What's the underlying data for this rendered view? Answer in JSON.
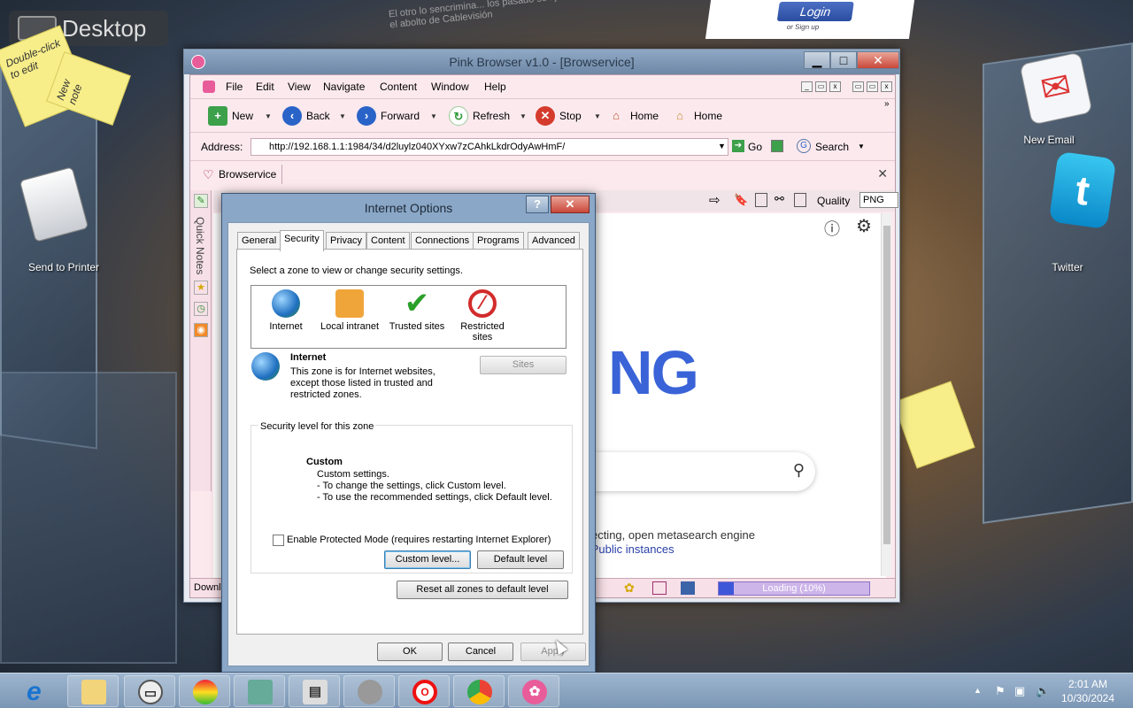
{
  "desktop": {
    "title": "Desktop",
    "note_a": "Double-click to edit",
    "note_b": "New note",
    "send_to_printer": "Send to Printer",
    "new_email": "New Email",
    "twitter": "Twitter",
    "login": "Login",
    "signup": "or Sign up",
    "bg_text": "El otro lo sencrimina... los pasado se fijo el abolto de Cablevisión"
  },
  "browser": {
    "title": "Pink Browser v1.0 - [Browservice]",
    "menu": [
      "File",
      "Edit",
      "View",
      "Navigate",
      "Content",
      "Window",
      "Help"
    ],
    "toolbar": {
      "new": "New",
      "back": "Back",
      "forward": "Forward",
      "refresh": "Refresh",
      "stop": "Stop",
      "home1": "Home",
      "home2": "Home"
    },
    "address_label": "Address:",
    "address_value": "http://192.168.1.1:1984/34/d2luylz040XYxw7zCAhkLkdrOdyAwHmF/",
    "go": "Go",
    "search": "Search",
    "tab_label": "Browservice",
    "sidebar_label": "Quick Notes",
    "quality_label": "Quality",
    "quality_value": "PNG",
    "page_brand": "NG",
    "page_text1": "especting, open metasearch engine",
    "page_text2": "ts | Public instances",
    "status_left": "Downl",
    "progress_text": "Loading (10%)",
    "progress_value": 0.1
  },
  "dialog": {
    "title": "Internet Options",
    "tabs": [
      "General",
      "Security",
      "Privacy",
      "Content",
      "Connections",
      "Programs",
      "Advanced"
    ],
    "select_zone": "Select a zone to view or change security settings.",
    "zones": [
      "Internet",
      "Local intranet",
      "Trusted sites",
      "Restricted sites"
    ],
    "zone_title": "Internet",
    "zone_desc": "This zone is for Internet websites, except those listed in trusted and restricted zones.",
    "sites": "Sites",
    "security_level": "Security level for this zone",
    "custom_title": "Custom",
    "custom_l1": "Custom settings.",
    "custom_l2": "- To change the settings, click Custom level.",
    "custom_l3": "- To use the recommended settings, click Default level.",
    "protected_mode": "Enable Protected Mode (requires restarting Internet Explorer)",
    "custom_level": "Custom level...",
    "default_level": "Default level",
    "reset_all": "Reset all zones to default level",
    "ok": "OK",
    "cancel": "Cancel",
    "apply": "Apply"
  },
  "taskbar": {
    "time": "2:01 AM",
    "date": "10/30/2024"
  },
  "colors": {
    "accent": "#3a63d8",
    "pink_bg": "#fbe9ee",
    "titlebar": "#8fa8c4"
  }
}
